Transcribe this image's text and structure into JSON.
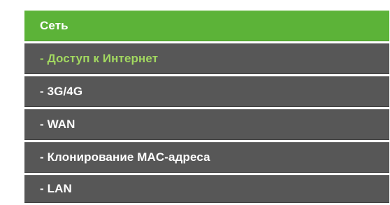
{
  "menu": {
    "header": "Сеть",
    "items": [
      {
        "label": "- Доступ к Интернет",
        "active": true
      },
      {
        "label": "- 3G/4G",
        "active": false
      },
      {
        "label": "- WAN",
        "active": false
      },
      {
        "label": "- Клонирование MAC-адреса",
        "active": false
      },
      {
        "label": "- LAN",
        "active": false
      }
    ]
  },
  "colors": {
    "header_bg": "#5cb338",
    "item_bg": "#575757",
    "active_text": "#a2d860",
    "text": "#ffffff"
  }
}
